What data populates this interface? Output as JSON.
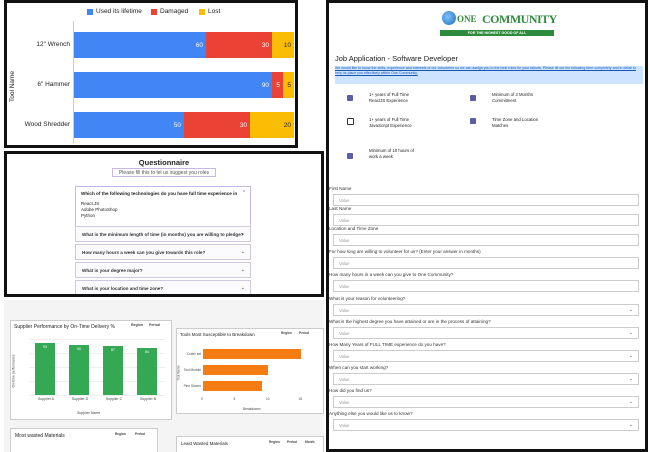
{
  "chart1": {
    "legend": [
      "Used its lifetime",
      "Damaged",
      "Lost"
    ],
    "colors": [
      "#4285f4",
      "#ea4335",
      "#fbbc04"
    ],
    "ylabel": "Tool Name",
    "chart_data": {
      "type": "bar",
      "orientation": "horizontal-stacked",
      "categories": [
        "12\" Wrench",
        "6\" Hammer",
        "Wood Shredder"
      ],
      "series": [
        {
          "name": "Used its lifetime",
          "values": [
            60,
            90,
            50
          ]
        },
        {
          "name": "Damaged",
          "values": [
            30,
            5,
            30
          ]
        },
        {
          "name": "Lost",
          "values": [
            10,
            5,
            20
          ]
        }
      ],
      "ylabel": "Tool Name",
      "xlim": [
        0,
        100
      ]
    }
  },
  "questionnaire": {
    "title": "Questionnaire",
    "subtitle": "Please fill this to let us suggest you roles",
    "q1": "Which of the following technologies do you have full time experience in",
    "q1_options": [
      "React.JS",
      "Adobe PhotoShop",
      "Python"
    ],
    "questions": [
      "What is the minimum length of time (in months) you are willing to pledge?",
      "How many hours a week can you give towards this role?",
      "What is your degree major?",
      "What is your location and time zone?"
    ]
  },
  "supplier_chart": {
    "title": "Supplier Performance by On-Time Delivery %",
    "legend": [
      "Region",
      "Period"
    ],
    "ylabel": "On-time performance",
    "xlabel": "Supplier Name",
    "chart_data": {
      "type": "bar",
      "categories": [
        "Supplier A",
        "Supplier D",
        "Supplier C",
        "Supplier B"
      ],
      "values": [
        93,
        90,
        87,
        84
      ],
      "xlabel": "Supplier Name",
      "ylabel": "On-time performance"
    }
  },
  "tools_chart": {
    "title": "Tools Most Susceptible to Breakdown",
    "legend": [
      "Region",
      "Period"
    ],
    "ylabel": "Tool Name",
    "xlabel": "Breakdowns",
    "chart_data": {
      "type": "bar",
      "orientation": "horizontal",
      "categories": [
        "Cutter set",
        "Tool Module",
        "Pine Shover"
      ],
      "values": [
        15,
        10,
        9
      ],
      "ticks": [
        "0",
        "5",
        "10",
        "15"
      ],
      "xlim": [
        0,
        16
      ]
    }
  },
  "bottom": {
    "left_title": "Most wasted Materials",
    "left_legend": [
      "Region",
      "Period"
    ],
    "right_title": "Least Wasted Materials",
    "right_legend": [
      "Region",
      "Period",
      "Month"
    ]
  },
  "application": {
    "logo_one": "ONE",
    "logo_community": "COMMUNITY",
    "logo_tagline": "FOR THE HIGHEST GOOD OF ALL",
    "title": "Job Application - Software Developer",
    "intro": "We would like to know the skills, experience and interests of our volunteers so we can assign you to the best roles for your talents. Please fill out the following form completely and in detail to help us place you effectively within One Community.",
    "checks": [
      {
        "label": "1+ years of Full Time ReactJS Experience",
        "checked": true
      },
      {
        "label": "Minimum of 3 Months Commitment",
        "checked": true
      },
      {
        "label": "1+ years of Full Time JavaScript Experience",
        "checked": false
      },
      {
        "label": "Time Zone and Location Matches",
        "checked": true
      },
      {
        "label": "Minimum of 10 hours of work a week",
        "checked": true
      }
    ],
    "fields": [
      {
        "label": "First Name",
        "placeholder": "Value",
        "select": false
      },
      {
        "label": "Last Name",
        "placeholder": "Value",
        "select": false
      },
      {
        "label": "Location and Time Zone",
        "placeholder": "Value",
        "select": false
      },
      {
        "label": "For how long are willing to volunteer for us? (Enter your answer in months)",
        "placeholder": "Value",
        "select": false
      },
      {
        "label": "How many hours in a week can you give to One Community?",
        "placeholder": "Value",
        "select": false
      },
      {
        "label": "What is your reason for volunteering?",
        "placeholder": "Value",
        "select": true
      },
      {
        "label": "What is the highest degree you have attained or are in the process of attaining?",
        "placeholder": "Value",
        "select": true
      },
      {
        "label": "How Many Years of FULL TIME experience do you have?",
        "placeholder": "Value",
        "select": true
      },
      {
        "label": "When can you start working?",
        "placeholder": "Value",
        "select": true
      },
      {
        "label": "How did you find us?",
        "placeholder": "Value",
        "select": true
      },
      {
        "label": "Anything else you would like us to know?",
        "placeholder": "Value",
        "select": true
      }
    ]
  }
}
